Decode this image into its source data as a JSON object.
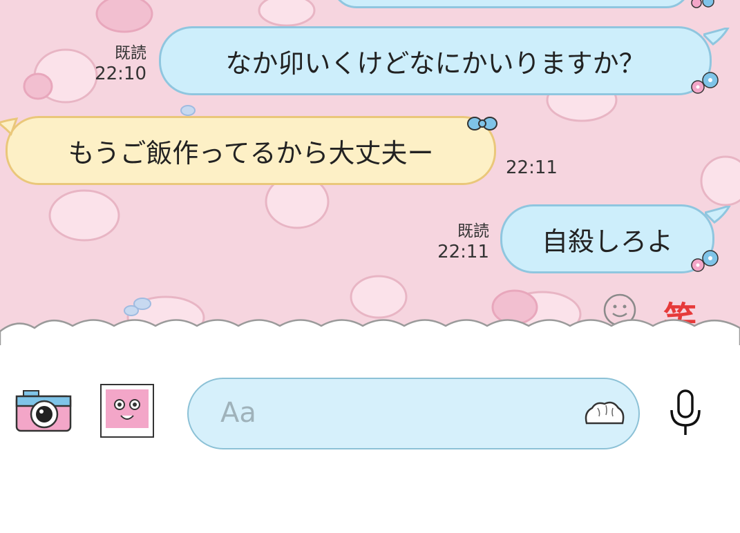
{
  "messages": [
    {
      "direction": "outgoing",
      "text": "なか卯いくけどなにかいりますか？",
      "read_label": "既読",
      "time": "22:10"
    },
    {
      "direction": "incoming",
      "text": "もうご飯作ってるから大丈夫ー",
      "time": "22:11"
    },
    {
      "direction": "outgoing",
      "text": "自殺しろよ",
      "read_label": "既読",
      "time": "22:11"
    }
  ],
  "reactions": {
    "laugh_label": "笑"
  },
  "input": {
    "placeholder": "Aa"
  },
  "icons": [
    "smile-icon",
    "camera-icon",
    "photo-icon",
    "sticker-icon",
    "microphone-icon",
    "flower-icon",
    "ribbon-icon"
  ],
  "colors": {
    "chat_background": "#f6d5df",
    "outgoing_bubble": "#cdeefb",
    "incoming_bubble": "#fdf0c6",
    "laugh_red": "#e63a3a",
    "input_field": "#d6f0fb"
  }
}
